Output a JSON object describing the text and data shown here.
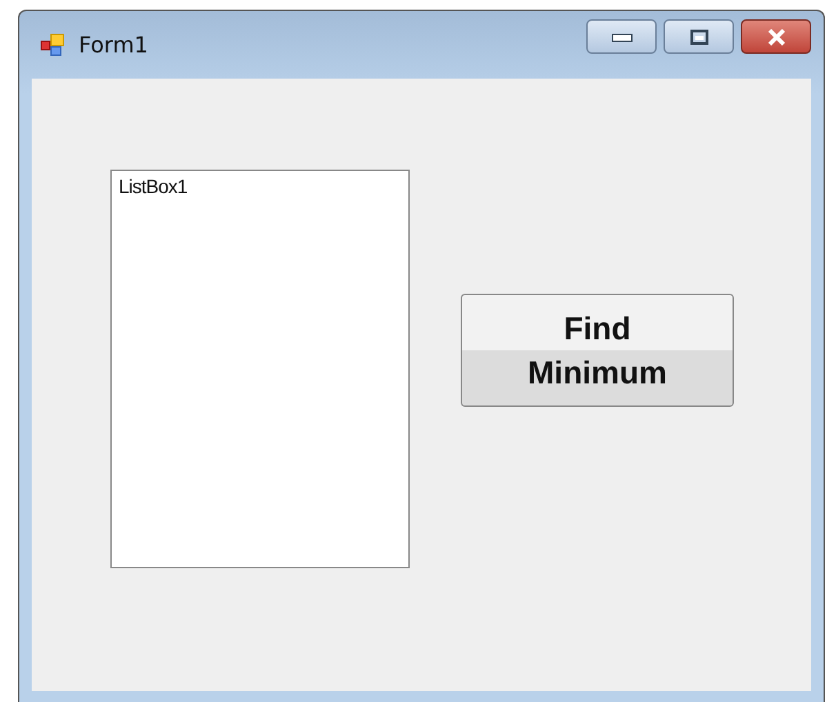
{
  "window": {
    "title": "Form1"
  },
  "listbox": {
    "items": [
      "ListBox1"
    ]
  },
  "button": {
    "label": "Find\nMinimum"
  }
}
